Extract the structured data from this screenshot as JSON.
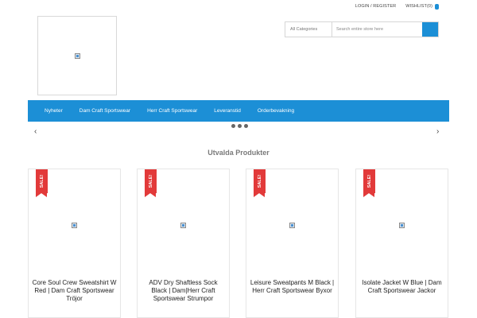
{
  "topbar": {
    "login_label": "LOGIN / REGISTER",
    "wishlist_label": "WISHLIST(0)"
  },
  "search": {
    "category_value": "All Categories",
    "placeholder": "Search entire store here"
  },
  "nav": {
    "items": [
      {
        "label": "Nyheter"
      },
      {
        "label": "Dam Craft Sportswear"
      },
      {
        "label": "Herr Craft Sportswear"
      },
      {
        "label": "Leveranstid"
      },
      {
        "label": "Orderbevakning"
      }
    ]
  },
  "slider": {
    "prev_icon": "chevron-left-icon",
    "next_icon": "chevron-right-icon"
  },
  "section": {
    "title": "Utvalda Produkter"
  },
  "products": [
    {
      "badge": "SALE!",
      "name": "Core Soul Crew Sweatshirt W Red | Dam Craft Sportswear Tröjor"
    },
    {
      "badge": "SALE!",
      "name": "ADV Dry Shaftless Sock Black | Dam|Herr Craft Sportswear Strumpor"
    },
    {
      "badge": "SALE!",
      "name": "Leisure Sweatpants M Black | Herr Craft Sportswear Byxor"
    },
    {
      "badge": "SALE!",
      "name": "Isolate Jacket W Blue | Dam Craft Sportswear Jackor"
    }
  ],
  "colors": {
    "accent": "#1c8fd6",
    "sale": "#e23a3a"
  }
}
